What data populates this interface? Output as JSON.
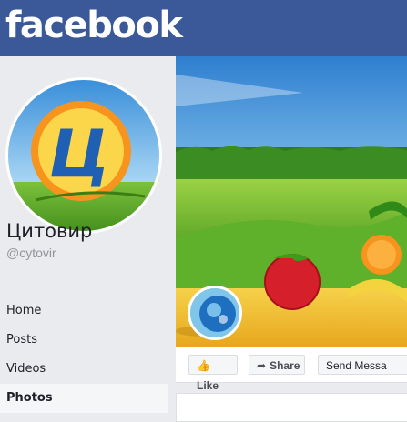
{
  "header": {
    "logo_text": "facebook",
    "bg_color": "#3b5998"
  },
  "page": {
    "name": "Цитовир",
    "handle": "@cytovir",
    "logo_letter": "Ц",
    "logo_accent": "#f7941d",
    "logo_blue": "#1f5fb4"
  },
  "sidebar": {
    "items": [
      {
        "label": "Home",
        "active": false
      },
      {
        "label": "Posts",
        "active": false
      },
      {
        "label": "Videos",
        "active": false
      },
      {
        "label": "Photos",
        "active": true
      }
    ]
  },
  "actions": {
    "like_label": "Like",
    "share_label": "Share",
    "message_label": "Send Messa"
  },
  "cover": {
    "description_icons": [
      "strawberry",
      "orange-slice",
      "lemon",
      "blue-tablet",
      "grass",
      "sky"
    ]
  }
}
